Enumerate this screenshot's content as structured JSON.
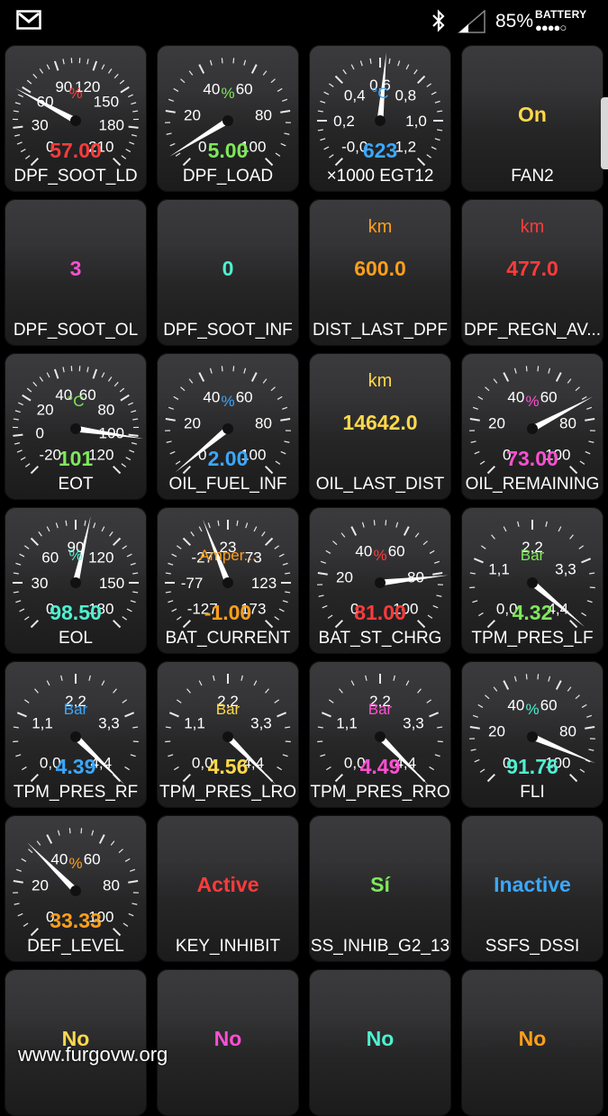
{
  "status_bar": {
    "battery_percent": "85%",
    "battery_label": "BATTERY",
    "battery_dots": "●●●●○",
    "icons": [
      "gmail-icon",
      "bluetooth-icon",
      "signal-icon"
    ]
  },
  "colors": {
    "red": "#ff3b3b",
    "green": "#7ee85a",
    "blue": "#3aa8ff",
    "yellow": "#ffd84a",
    "orange": "#ff9f1a",
    "magenta": "#ff4fd1",
    "cyan": "#4ef0d0"
  },
  "tiles": [
    {
      "type": "gauge",
      "label": "DPF_SOOT_LD",
      "unit": "%",
      "unit_color": "#ff3b3b",
      "value": "57.00",
      "value_color": "#ff3b3b",
      "ticks": [
        "0",
        "30",
        "60",
        "90",
        "120",
        "150",
        "180",
        "210"
      ],
      "min": 0,
      "max": 210,
      "reading": 57
    },
    {
      "type": "gauge",
      "label": "DPF_LOAD",
      "unit": "%",
      "unit_color": "#7ee85a",
      "value": "5.00",
      "value_color": "#7ee85a",
      "ticks": [
        "0",
        "20",
        "40",
        "60",
        "80",
        "100"
      ],
      "min": 0,
      "max": 100,
      "reading": 5
    },
    {
      "type": "gauge",
      "label": "×1000 EGT12",
      "unit": "°C",
      "unit_color": "#3aa8ff",
      "value": "623",
      "value_color": "#3aa8ff",
      "ticks": [
        "-0,0",
        "0,2",
        "0,4",
        "0,6",
        "0,8",
        "1,0",
        "1,2"
      ],
      "min": 0,
      "max": 1.2,
      "reading": 0.623
    },
    {
      "type": "text",
      "label": "FAN2",
      "unit": "",
      "unit_color": "#ffd84a",
      "value": "On",
      "value_color": "#ffd84a"
    },
    {
      "type": "text",
      "label": "DPF_SOOT_OL",
      "unit": "",
      "unit_color": "#ff4fd1",
      "value": "3",
      "value_color": "#ff4fd1"
    },
    {
      "type": "text",
      "label": "DPF_SOOT_INF",
      "unit": "",
      "unit_color": "#4ef0d0",
      "value": "0",
      "value_color": "#4ef0d0"
    },
    {
      "type": "text",
      "label": "DIST_LAST_DPF",
      "unit": "km",
      "unit_color": "#ff9f1a",
      "value": "600.0",
      "value_color": "#ff9f1a"
    },
    {
      "type": "text",
      "label": "DPF_REGN_AV...",
      "unit": "km",
      "unit_color": "#ff3b3b",
      "value": "477.0",
      "value_color": "#ff3b3b"
    },
    {
      "type": "gauge",
      "label": "EOT",
      "unit": "°C",
      "unit_color": "#7ee85a",
      "value": "101",
      "value_color": "#7ee85a",
      "ticks": [
        "-20",
        "0",
        "20",
        "40",
        "60",
        "80",
        "100",
        "120"
      ],
      "min": -20,
      "max": 120,
      "reading": 101
    },
    {
      "type": "gauge",
      "label": "OIL_FUEL_INF",
      "unit": "%",
      "unit_color": "#3aa8ff",
      "value": "2.00",
      "value_color": "#3aa8ff",
      "ticks": [
        "0",
        "20",
        "40",
        "60",
        "80",
        "100"
      ],
      "min": 0,
      "max": 100,
      "reading": 2
    },
    {
      "type": "text",
      "label": "OIL_LAST_DIST",
      "unit": "km",
      "unit_color": "#ffd84a",
      "value": "14642.0",
      "value_color": "#ffd84a"
    },
    {
      "type": "gauge",
      "label": "OIL_REMAINING",
      "unit": "%",
      "unit_color": "#ff4fd1",
      "value": "73.00",
      "value_color": "#ff4fd1",
      "ticks": [
        "0",
        "20",
        "40",
        "60",
        "80",
        "100"
      ],
      "min": 0,
      "max": 100,
      "reading": 73
    },
    {
      "type": "gauge",
      "label": "EOL",
      "unit": "%",
      "unit_color": "#4ef0d0",
      "value": "98.50",
      "value_color": "#4ef0d0",
      "ticks": [
        "0",
        "30",
        "60",
        "90",
        "120",
        "150",
        "180"
      ],
      "min": 0,
      "max": 180,
      "reading": 98.5
    },
    {
      "type": "gauge",
      "label": "BAT_CURRENT",
      "unit": "Amper...",
      "unit_color": "#ff9f1a",
      "value": "-1.00",
      "value_color": "#ff9f1a",
      "ticks": [
        "-127",
        "-77",
        "-27",
        "23",
        "73",
        "123",
        "173"
      ],
      "min": -127,
      "max": 173,
      "reading": -1
    },
    {
      "type": "gauge",
      "label": "BAT_ST_CHRG",
      "unit": "%",
      "unit_color": "#ff3b3b",
      "value": "81.00",
      "value_color": "#ff3b3b",
      "ticks": [
        "0",
        "20",
        "40",
        "60",
        "80",
        "100"
      ],
      "min": 0,
      "max": 100,
      "reading": 81
    },
    {
      "type": "gauge",
      "label": "TPM_PRES_LF",
      "unit": "Bar",
      "unit_color": "#7ee85a",
      "value": "4.32",
      "value_color": "#7ee85a",
      "ticks": [
        "0,0",
        "1,1",
        "2,2",
        "3,3",
        "4,4"
      ],
      "min": 0,
      "max": 4.4,
      "reading": 4.32
    },
    {
      "type": "gauge",
      "label": "TPM_PRES_RF",
      "unit": "Bar",
      "unit_color": "#3aa8ff",
      "value": "4.39",
      "value_color": "#3aa8ff",
      "ticks": [
        "0,0",
        "1,1",
        "2,2",
        "3,3",
        "4,4"
      ],
      "min": 0,
      "max": 4.4,
      "reading": 4.39
    },
    {
      "type": "gauge",
      "label": "TPM_PRES_LRO",
      "unit": "Bar",
      "unit_color": "#ffd84a",
      "value": "4.56",
      "value_color": "#ffd84a",
      "ticks": [
        "0,0",
        "1,1",
        "2,2",
        "3,3",
        "4,4"
      ],
      "min": 0,
      "max": 4.4,
      "reading": 4.4
    },
    {
      "type": "gauge",
      "label": "TPM_PRES_RRO",
      "unit": "Bar",
      "unit_color": "#ff4fd1",
      "value": "4.49",
      "value_color": "#ff4fd1",
      "ticks": [
        "0,0",
        "1,1",
        "2,2",
        "3,3",
        "4,4"
      ],
      "min": 0,
      "max": 4.4,
      "reading": 4.4
    },
    {
      "type": "gauge",
      "label": "FLI",
      "unit": "%",
      "unit_color": "#4ef0d0",
      "value": "91.76",
      "value_color": "#4ef0d0",
      "ticks": [
        "0",
        "20",
        "40",
        "60",
        "80",
        "100"
      ],
      "min": 0,
      "max": 100,
      "reading": 91.76
    },
    {
      "type": "gauge",
      "label": "DEF_LEVEL",
      "unit": "%",
      "unit_color": "#ff9f1a",
      "value": "33.33",
      "value_color": "#ff9f1a",
      "ticks": [
        "0",
        "20",
        "40",
        "60",
        "80",
        "100"
      ],
      "min": 0,
      "max": 100,
      "reading": 33.33
    },
    {
      "type": "text",
      "label": "KEY_INHIBIT",
      "unit": "",
      "unit_color": "#ff3b3b",
      "value": "Active",
      "value_color": "#ff3b3b"
    },
    {
      "type": "text",
      "label": "SS_INHIB_G2_13",
      "unit": "",
      "unit_color": "#7ee85a",
      "value": "Sí",
      "value_color": "#7ee85a"
    },
    {
      "type": "text",
      "label": "SSFS_DSSI",
      "unit": "",
      "unit_color": "#3aa8ff",
      "value": "Inactive",
      "value_color": "#3aa8ff"
    },
    {
      "type": "text",
      "label": "",
      "unit": "",
      "unit_color": "#ffd84a",
      "value": "No",
      "value_color": "#ffd84a"
    },
    {
      "type": "text",
      "label": "",
      "unit": "",
      "unit_color": "#ff4fd1",
      "value": "No",
      "value_color": "#ff4fd1"
    },
    {
      "type": "text",
      "label": "",
      "unit": "",
      "unit_color": "#4ef0d0",
      "value": "No",
      "value_color": "#4ef0d0"
    },
    {
      "type": "text",
      "label": "",
      "unit": "",
      "unit_color": "#ff9f1a",
      "value": "No",
      "value_color": "#ff9f1a"
    }
  ],
  "watermark": "www.furgovw.org"
}
